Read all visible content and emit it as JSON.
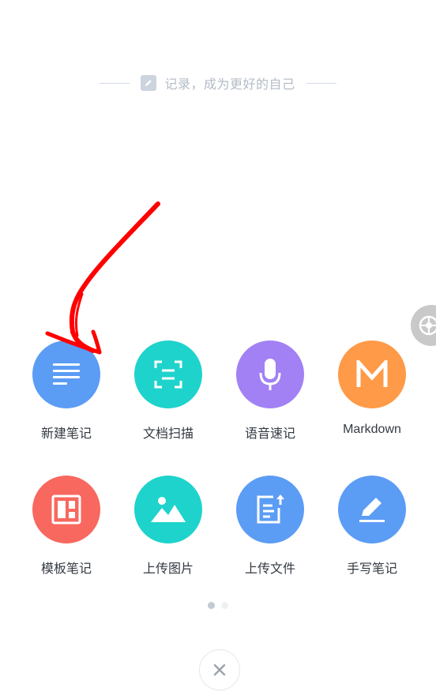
{
  "header": {
    "slogan": "记录，成为更好的自己"
  },
  "colors": {
    "blue": "#5b9cf5",
    "teal": "#1ed3cc",
    "purple": "#a181f4",
    "orange": "#ff9a48",
    "red": "#f8685f",
    "annotation_red": "#ff0000"
  },
  "actions": [
    {
      "label": "新建笔记",
      "icon": "lines-icon",
      "color": "blue"
    },
    {
      "label": "文档扫描",
      "icon": "scan-icon",
      "color": "teal"
    },
    {
      "label": "语音速记",
      "icon": "microphone-icon",
      "color": "purple"
    },
    {
      "label": "Markdown",
      "icon": "markdown-m-icon",
      "color": "orange"
    },
    {
      "label": "模板笔记",
      "icon": "template-icon",
      "color": "red"
    },
    {
      "label": "上传图片",
      "icon": "image-icon",
      "color": "teal"
    },
    {
      "label": "上传文件",
      "icon": "upload-file-icon",
      "color": "blue"
    },
    {
      "label": "手写笔记",
      "icon": "pen-icon",
      "color": "blue"
    }
  ],
  "pager": {
    "pages": 2,
    "current": 1
  },
  "close": {
    "icon": "close-icon"
  },
  "floating": {
    "icon": "assistive-touch-icon"
  }
}
